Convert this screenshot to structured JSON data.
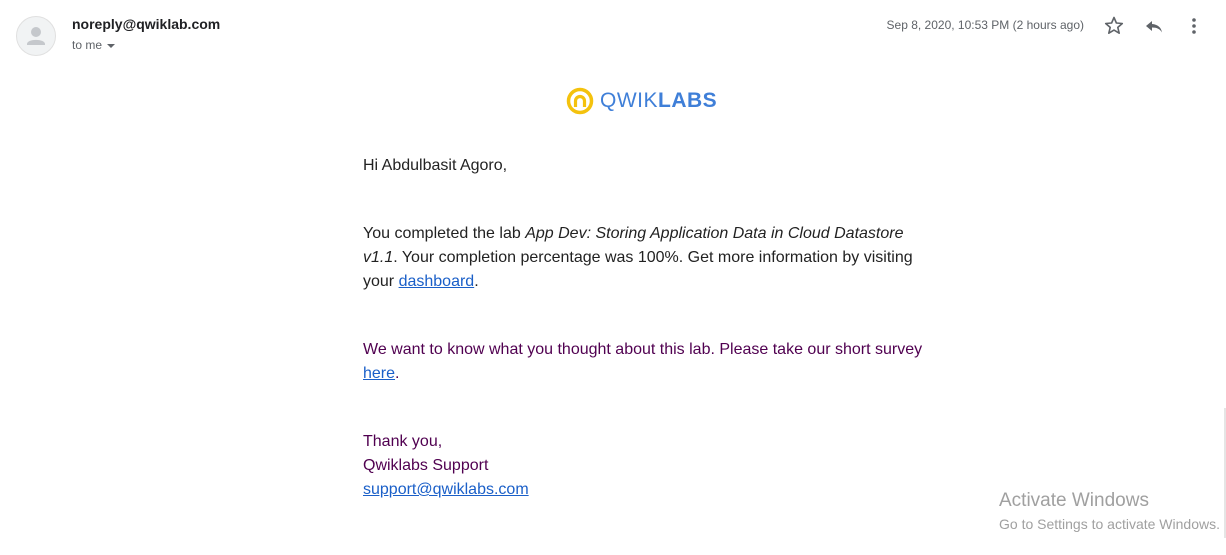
{
  "header": {
    "sender": "noreply@qwiklab.com",
    "recipient": "to me",
    "date": "Sep 8, 2020, 10:53 PM (2 hours ago)",
    "icons": [
      "person-icon",
      "star-icon",
      "reply-icon",
      "more-vert-icon"
    ]
  },
  "logo": {
    "light": "QWIK",
    "bold": "LABS",
    "colors": {
      "circle": "#f4c20d",
      "text": "#3f7fd8"
    }
  },
  "email": {
    "greeting": "Hi Abdulbasit Agoro,",
    "p1_pre": "You completed the lab ",
    "lab_name": "App Dev: Storing Application Data in Cloud Datastore v1.1",
    "p1_mid": ". Your completion percentage was 100%. Get more information by visiting your ",
    "dashboard_link": "dashboard",
    "p1_end": ".",
    "p2_pre": "We want to know what you thought about this lab. Please take our short survey ",
    "here_link": "here",
    "p2_end": ".",
    "thanks": "Thank you,",
    "signature": "Qwiklabs Support",
    "support_email": "support@qwiklabs.com"
  },
  "watermark": {
    "title": "Activate Windows",
    "subtitle": "Go to Settings to activate Windows."
  },
  "colors": {
    "link": "#1a5fc8",
    "quoted_text": "#500050",
    "muted": "#5f6368"
  }
}
